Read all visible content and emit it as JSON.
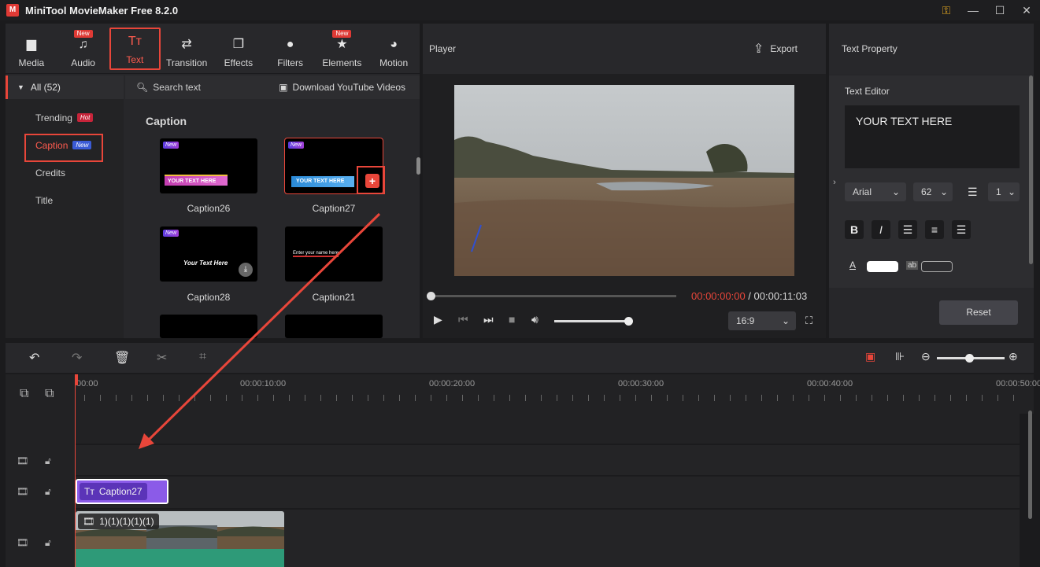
{
  "window": {
    "title": "MiniTool MovieMaker Free 8.2.0",
    "icons": [
      "key-icon",
      "minimize-icon",
      "maximize-icon",
      "close-icon"
    ]
  },
  "toolbar": {
    "items": [
      {
        "label": "Media",
        "icon": "folder-icon",
        "badge": ""
      },
      {
        "label": "Audio",
        "icon": "music-icon",
        "badge": "New"
      },
      {
        "label": "Text",
        "icon": "text-icon",
        "badge": ""
      },
      {
        "label": "Transition",
        "icon": "transition-icon",
        "badge": ""
      },
      {
        "label": "Effects",
        "icon": "effects-icon",
        "badge": ""
      },
      {
        "label": "Filters",
        "icon": "filters-icon",
        "badge": ""
      },
      {
        "label": "Elements",
        "icon": "elements-icon",
        "badge": "New"
      },
      {
        "label": "Motion",
        "icon": "motion-icon",
        "badge": ""
      }
    ],
    "active": "Text"
  },
  "library": {
    "all_label": "All (52)",
    "categories": [
      {
        "label": "Trending",
        "badge": "Hot"
      },
      {
        "label": "Caption",
        "badge": "New"
      },
      {
        "label": "Credits",
        "badge": ""
      },
      {
        "label": "Title",
        "badge": ""
      }
    ],
    "selected_category": "Caption",
    "search_placeholder": "Search text",
    "download_label": "Download YouTube Videos",
    "section_title": "Caption",
    "thumbnails": [
      {
        "label": "Caption26",
        "badge": "New",
        "overlay": "YOUR TEXT HERE"
      },
      {
        "label": "Caption27",
        "badge": "New",
        "overlay": "YOUR TEXT HERE"
      },
      {
        "label": "Caption28",
        "badge": "New",
        "overlay": "Your Text Here"
      },
      {
        "label": "Caption21",
        "badge": "",
        "overlay": "Enter your name here"
      }
    ],
    "add_button": "+"
  },
  "player": {
    "title": "Player",
    "export_label": "Export",
    "current_time": "00:00:00:00",
    "separator": " / ",
    "total_time": "00:00:11:03",
    "progress": 0,
    "volume": 0.95,
    "aspect_ratio": "16:9"
  },
  "text_property": {
    "title": "Text Property",
    "editor_label": "Text Editor",
    "editor_text": "YOUR TEXT HERE",
    "font": "Arial",
    "size": "62",
    "line_spacing": "1",
    "format_buttons": [
      "B",
      "I"
    ],
    "reset_label": "Reset",
    "color_swatch": "#ffffff",
    "side_tab": "›"
  },
  "timeline": {
    "ruler_labels": [
      "00:00",
      "00:00:10:00",
      "00:00:20:00",
      "00:00:30:00",
      "00:00:40:00",
      "00:00:50:00"
    ],
    "caption_clip": "Caption27",
    "video_clip": "1)(1)(1)(1)(1)",
    "zoom": 0.42,
    "accent": "#e8463a"
  }
}
